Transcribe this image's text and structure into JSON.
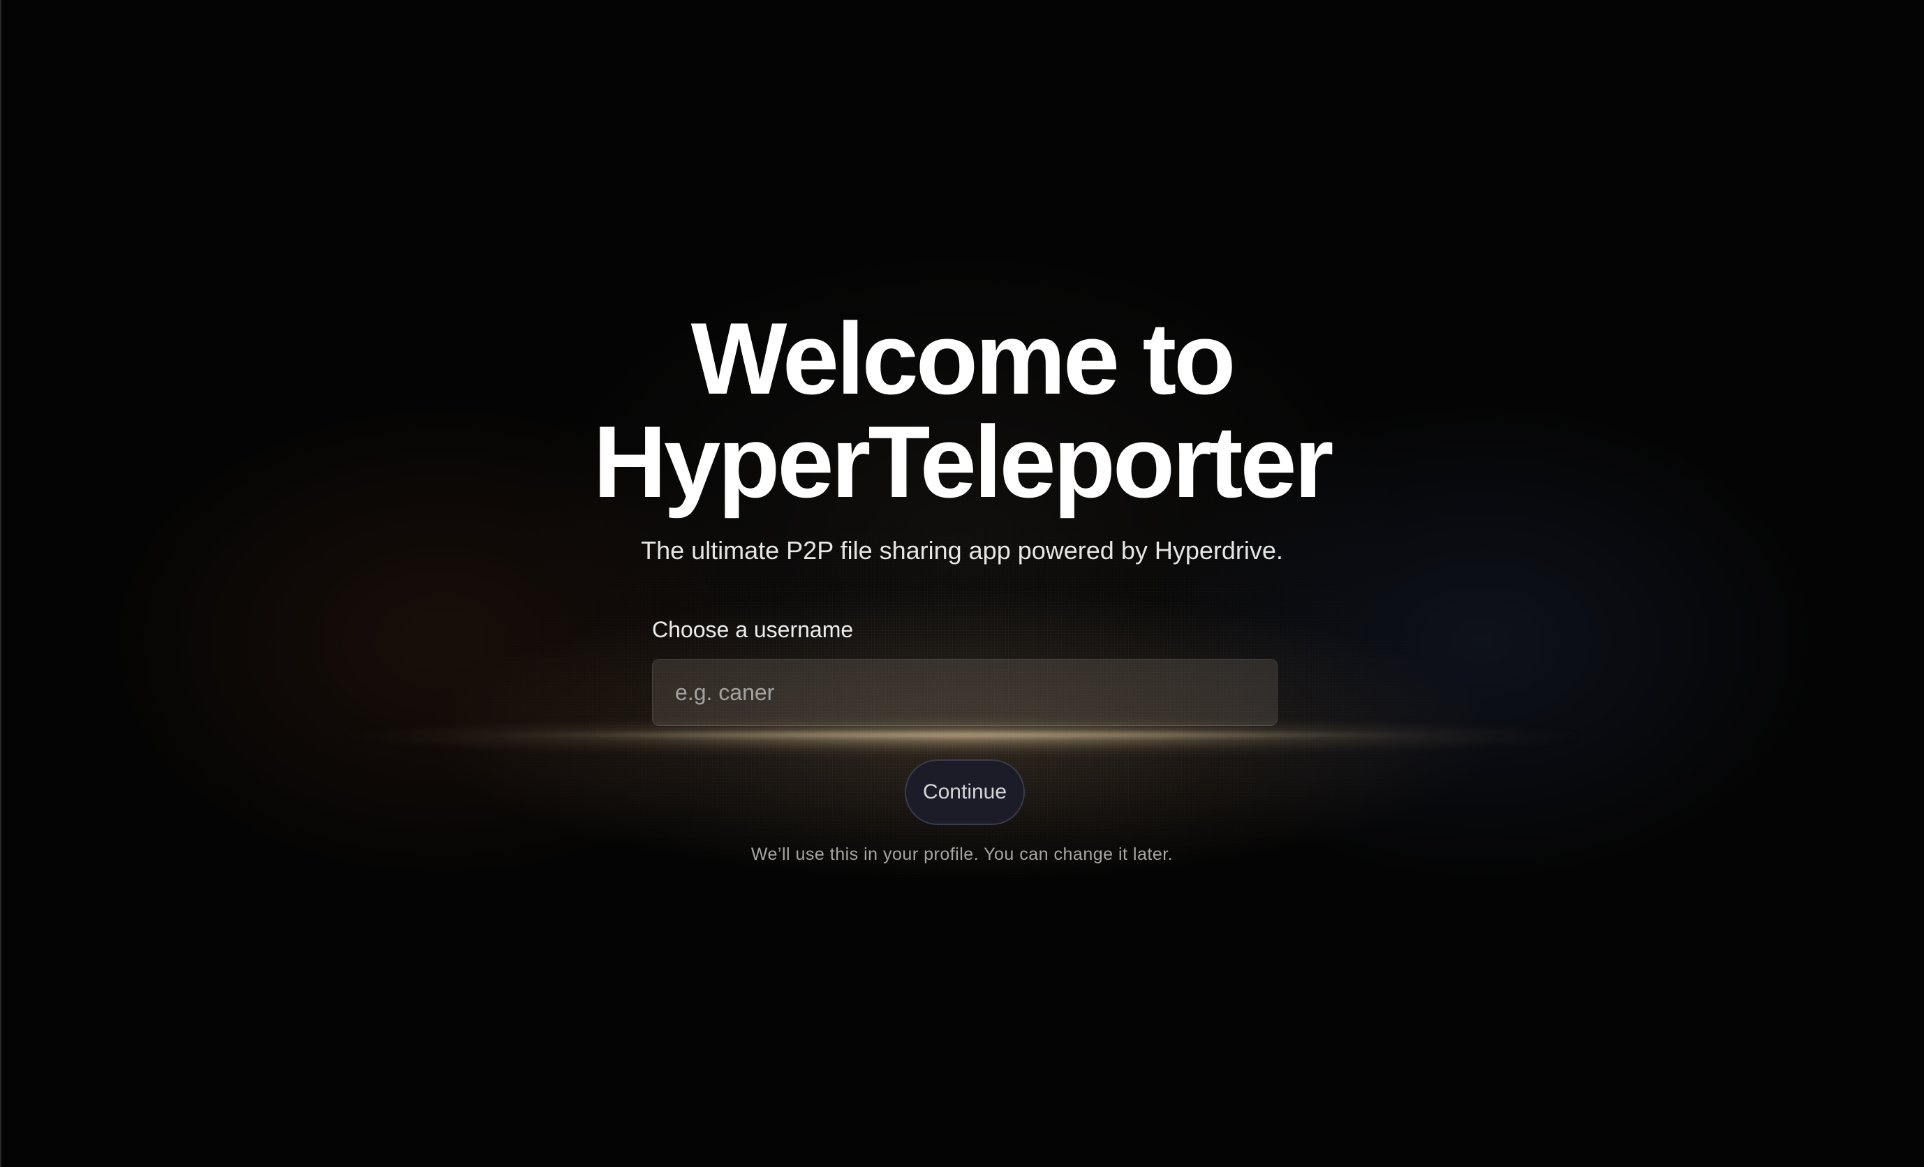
{
  "welcome": {
    "title_line1": "Welcome to",
    "title_line2": "HyperTeleporter",
    "subtitle": "The ultimate P2P file sharing app powered by Hyperdrive."
  },
  "form": {
    "username_label": "Choose a username",
    "username_value": "",
    "username_placeholder": "e.g. caner",
    "continue_label": "Continue",
    "helper_text": "We’ll use this in your profile. You can change it later."
  },
  "colors": {
    "background": "#040404",
    "title": "#ffffff",
    "button_background": "#1b1c28",
    "helper_text": "#a6a6a6"
  }
}
